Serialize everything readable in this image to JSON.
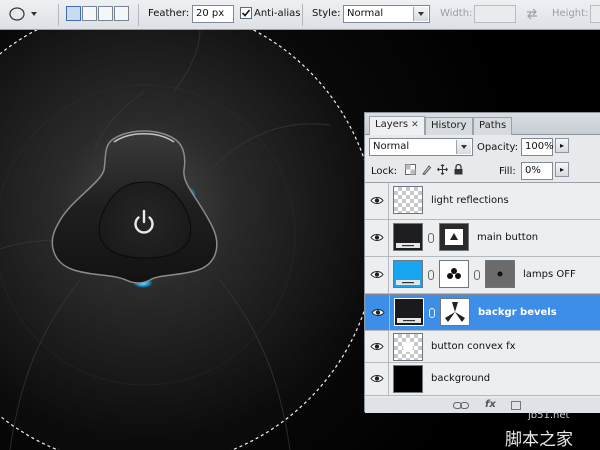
{
  "options_bar": {
    "feather_label": "Feather:",
    "feather_value": "20 px",
    "antialias_label": "Anti-alias",
    "antialias_checked": true,
    "style_label": "Style:",
    "style_value": "Normal",
    "width_label": "Width:",
    "height_label": "Height:"
  },
  "layers_panel": {
    "tabs": [
      {
        "label": "Layers",
        "active": true
      },
      {
        "label": "History",
        "active": false
      },
      {
        "label": "Paths",
        "active": false
      }
    ],
    "blend_mode": "Normal",
    "opacity_label": "Opacity:",
    "opacity_value": "100%",
    "lock_label": "Lock:",
    "fill_label": "Fill:",
    "fill_value": "0%",
    "layers": [
      {
        "name": "light reflections",
        "selected": false,
        "visible": true
      },
      {
        "name": "main button",
        "selected": false,
        "visible": true
      },
      {
        "name": "lamps OFF",
        "selected": false,
        "visible": true
      },
      {
        "name": "backgr bevels",
        "selected": true,
        "visible": true
      },
      {
        "name": "button convex fx",
        "selected": false,
        "visible": true
      },
      {
        "name": "background",
        "selected": false,
        "visible": true
      }
    ],
    "fx_label": "fx"
  },
  "watermark": {
    "line1": "jb51.net",
    "line2": "脚本之家"
  },
  "colors": {
    "selection_blue": "#3d8ee8",
    "lamp_cyan": "#18a6f0"
  }
}
